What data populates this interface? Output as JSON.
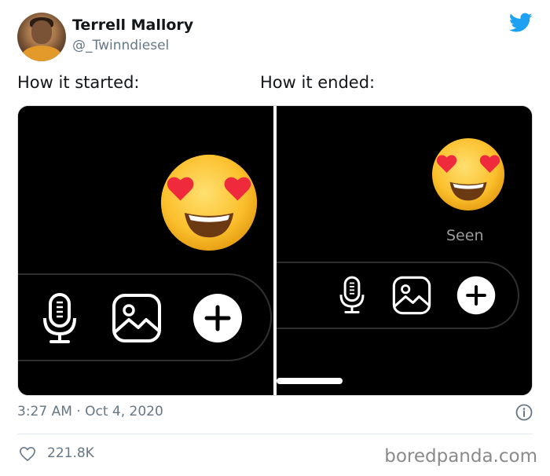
{
  "tweet": {
    "author_name": "Terrell Mallory",
    "author_handle": "@_Twinndiesel",
    "caption_left": "How it started:",
    "caption_right": "How it ended:",
    "timestamp": "3:27 AM · Oct 4, 2020",
    "likes": "221.8K"
  },
  "media": {
    "right_panel_status": "Seen"
  },
  "watermark": "boredpanda.com",
  "colors": {
    "twitter_blue": "#1da1f2",
    "muted_text": "#657786",
    "separator": "#e1e8ed"
  },
  "icons": [
    "twitter-bird-icon",
    "microphone-icon",
    "gallery-icon",
    "plus-circle-icon",
    "heart-eyes-emoji",
    "info-icon",
    "heart-icon"
  ]
}
